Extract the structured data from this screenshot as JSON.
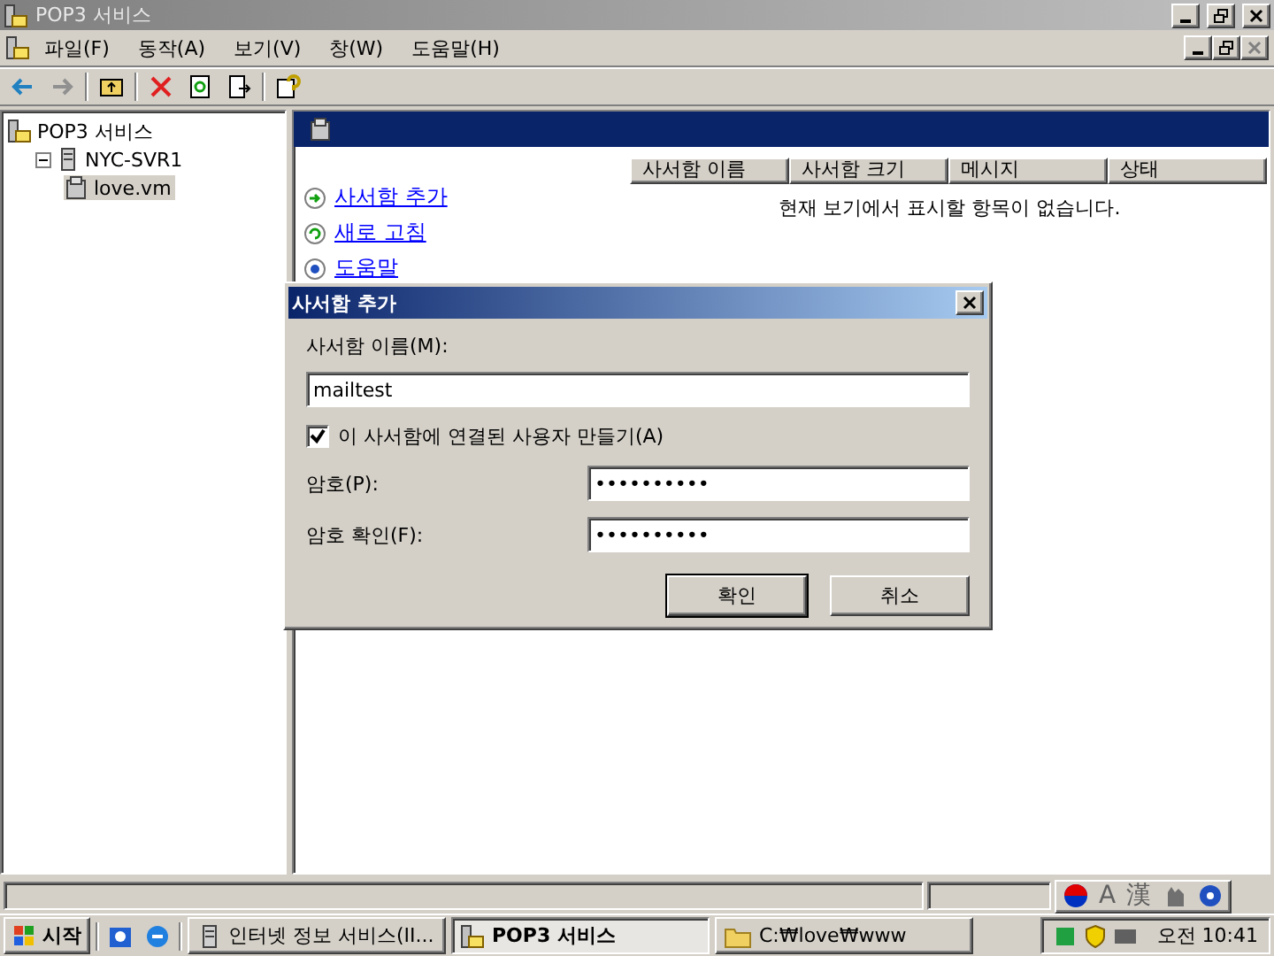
{
  "window": {
    "title": "POP3 서비스"
  },
  "menu": [
    "파일(F)",
    "동작(A)",
    "보기(V)",
    "창(W)",
    "도움말(H)"
  ],
  "tree": [
    {
      "label": "POP3 서비스",
      "children": [
        {
          "label": "NYC-SVR1",
          "expanded": true,
          "children": [
            {
              "label": "love.vm",
              "selected": true
            }
          ]
        }
      ]
    }
  ],
  "tasks": [
    {
      "label": "사서함 추가",
      "kind": "add"
    },
    {
      "label": "새로 고침",
      "kind": "refresh"
    },
    {
      "label": "도움말",
      "kind": "help"
    }
  ],
  "table": {
    "columns": [
      "사서함 이름",
      "사서함 크기",
      "메시지",
      "상태"
    ],
    "empty_message": "현재 보기에서 표시할 항목이 없습니다."
  },
  "dialog": {
    "title": "사서함 추가",
    "name_label": "사서함 이름(M):",
    "name_value": "mailtest",
    "create_user": {
      "label": "이 사서함에 연결된 사용자 만들기(A)",
      "checked": true
    },
    "password_label": "암호(P):",
    "password_value": "••••••••••",
    "confirm_label": "암호 확인(F):",
    "confirm_value": "••••••••••",
    "buttons": [
      "확인",
      "취소"
    ]
  },
  "language_bar": [
    "A",
    "漢"
  ],
  "taskbar": {
    "start": "시작",
    "tasks": [
      {
        "label": "인터넷 정보 서비스(II...",
        "kind": "iis",
        "selected": false
      },
      {
        "label": "POP3 서비스",
        "kind": "pop3",
        "selected": true
      },
      {
        "label": "C:₩love₩www",
        "kind": "folder",
        "selected": false
      }
    ],
    "clock": "오전 10:41"
  }
}
